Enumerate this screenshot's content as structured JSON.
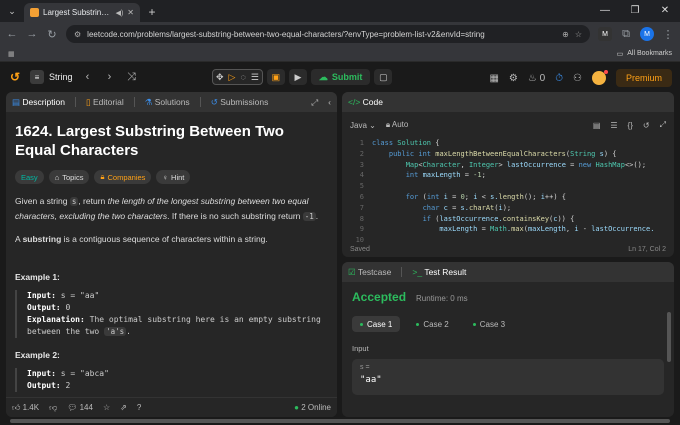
{
  "browser": {
    "tab_title": "Largest Substring Betwee",
    "url": "leetcode.com/problems/largest-substring-between-two-equal-characters/?envType=problem-list-v2&envId=string",
    "bookmarks_label": "All Bookmarks",
    "ext1": "M",
    "ext2": "M"
  },
  "lcnav": {
    "problem_list": "Problem List",
    "list_name": "String",
    "submit": "Submit",
    "streak": "0",
    "premium": "Premium"
  },
  "left": {
    "tabs": [
      "Description",
      "Editorial",
      "Solutions",
      "Submissions"
    ],
    "title": "1624. Largest Substring Between Two Equal Characters",
    "chips": {
      "difficulty": "Easy",
      "topics": "Topics",
      "companies": "Companies",
      "hint": "Hint"
    },
    "desc1a": "Given a string ",
    "desc1s": "s",
    "desc1b": ", return ",
    "desc1c": "the length of the longest substring between two equal characters, excluding the two characters",
    "desc1d": ". If there is no such substring return ",
    "desc1e": "-1",
    "desc1f": ".",
    "desc2a": "A ",
    "desc2b": "substring",
    "desc2c": " is a contiguous sequence of characters within a string.",
    "ex1_title": "Example 1:",
    "ex1_input_label": "Input:",
    "ex1_input": "s = \"aa\"",
    "ex1_output_label": "Output:",
    "ex1_output": "0",
    "ex1_expl_label": "Explanation:",
    "ex1_expl": "The optimal substring here is an empty substring between the two ",
    "ex1_expl_code": "'a's",
    "ex2_title": "Example 2:",
    "ex2_input_label": "Input:",
    "ex2_input": "s = \"abca\"",
    "ex2_output_label": "Output:",
    "ex2_output": "2",
    "likes": "1.4K",
    "comments": "144",
    "online": "2 Online"
  },
  "code": {
    "title": "Code",
    "language": "Java",
    "auto": "Auto",
    "saved": "Saved",
    "position": "Ln 17, Col 2",
    "line_numbers": [
      "1",
      "2",
      "3",
      "4",
      "5",
      "6",
      "7",
      "8",
      "9",
      "10"
    ]
  },
  "test": {
    "tabs": [
      "Testcase",
      "Test Result"
    ],
    "verdict": "Accepted",
    "runtime": "Runtime: 0 ms",
    "cases": [
      "Case 1",
      "Case 2",
      "Case 3"
    ],
    "input_label": "Input",
    "var": "s =",
    "value": "\"aa\""
  },
  "colors": {
    "accent": "#ffa116",
    "accepted": "#2cbb5d",
    "easy": "#00b8a3"
  }
}
